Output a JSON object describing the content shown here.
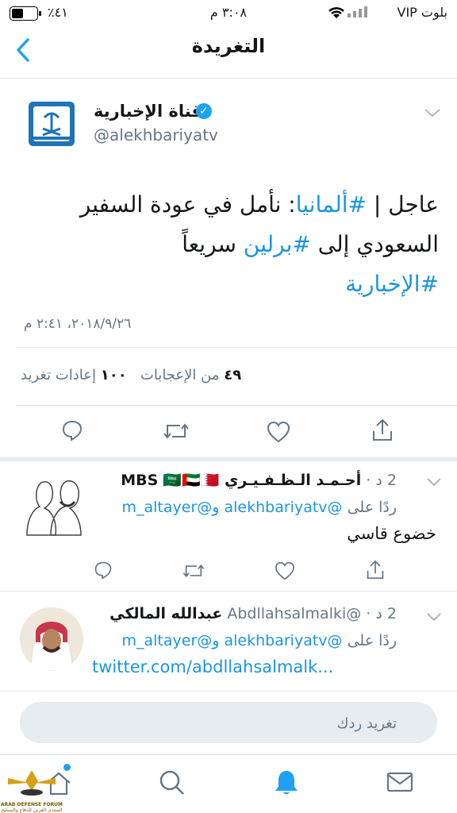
{
  "status_bar": {
    "carrier": "بلوت VIP",
    "time": "٣:٠٨ م",
    "battery": "٪٤١"
  },
  "nav": {
    "title": "التغريدة"
  },
  "main_tweet": {
    "author_name": "قناة الإخبارية",
    "author_handle": "@alekhbariyatv",
    "text_prefix": "عاجل | ",
    "hashtag1": "#ألمانيا",
    "text_middle": ": نأمل في عودة السفير السعودي إلى ",
    "hashtag2": "#برلين",
    "text_suffix": " سريعاً",
    "hashtag3": "#الإخبارية",
    "date": "٢٠١٨/٩/٢٦، ٢:٤١ م",
    "likes_count": "٤٩",
    "likes_label": "من الإعجابات",
    "retweets_count": "١٠٠",
    "retweets_label": "إعادات تغريد"
  },
  "replies": [
    {
      "time": "2 د",
      "name": "أحـمـد الـظـفـيـري MBS",
      "flags": "🇸🇦🇦🇪🇧🇭",
      "reply_to_label": "ردًا على",
      "reply_to_handles": "@alekhbariyatv و@m_altayer",
      "text": "خضوع قاسي"
    },
    {
      "time": "2 د",
      "name": "عبدالله المالكي",
      "handle": "@Abdllahsalmalki",
      "reply_to_label": "ردًا على",
      "reply_to_handles": "@alekhbariyatv و@m_altayer",
      "text": "twitter.com/abdllahsalmalk..."
    }
  ],
  "reply_box": {
    "placeholder": "تغريد ردك"
  },
  "watermark": {
    "line1": "ARAB DEFENSE FORUM",
    "line2": "المنتدى العربي للدفاع والتسليح"
  },
  "colors": {
    "accent": "#1b95e0",
    "muted": "#657786",
    "divider": "#e1e8ed"
  }
}
